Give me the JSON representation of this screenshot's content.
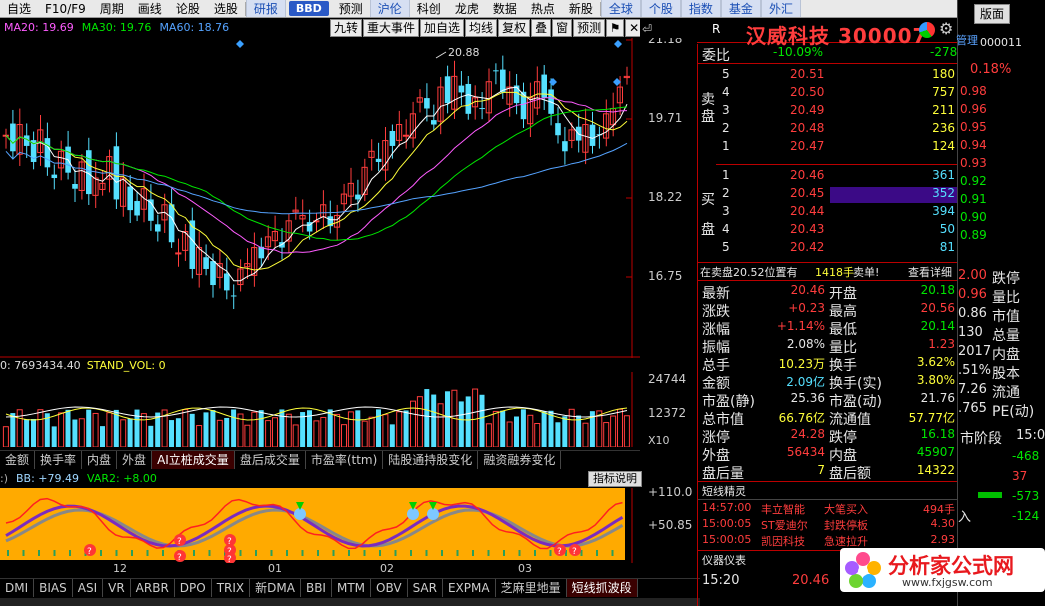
{
  "nav": [
    "自选",
    "F10/F9",
    "周期",
    "画线",
    "论股",
    "选股",
    "研报",
    "BBD",
    "预测",
    "沪伦",
    "科创",
    "龙虎",
    "数据",
    "热点",
    "新股",
    "全球",
    "个股",
    "指数",
    "基金",
    "外汇"
  ],
  "nav_highlight": [
    "研报",
    "沪伦",
    "全球",
    "个股",
    "指数",
    "基金",
    "外汇"
  ],
  "legend": {
    "ma20": "MA20: 19.69",
    "ma30": "MA30: 19.76",
    "ma60": "MA60: 18.76"
  },
  "toolbar": [
    "九转",
    "重大事件",
    "加自选",
    "均线",
    "复权",
    "叠",
    "窗",
    "预测"
  ],
  "price_axis": [
    "21.18",
    "19.71",
    "18.22",
    "16.75"
  ],
  "high_marker": "20.88",
  "volume": {
    "header": "0: 7693434.40",
    "stand_vol": "STAND_VOL: 0",
    "axis": [
      "24744",
      "12372",
      "X10"
    ]
  },
  "tabs1": [
    "金额",
    "换手率",
    "内盘",
    "外盘",
    "AI立桩成交量",
    "盘后成交量",
    "市盈率(ttm)",
    "陆股通持股变化",
    "融资融券变化"
  ],
  "tabs1_active": "AI立桩成交量",
  "indicator": {
    "bb": "BB: +79.49",
    "var2": "VAR2: +8.00",
    "button": "指标说明",
    "axis": [
      "+110.0",
      "+50.85"
    ]
  },
  "x_axis": [
    "12",
    "01",
    "02",
    "03"
  ],
  "tabs2": [
    "DMI",
    "BIAS",
    "ASI",
    "VR",
    "ARBR",
    "DPO",
    "TRIX",
    "新DMA",
    "BBI",
    "MTM",
    "OBV",
    "SAR",
    "EXPMA",
    "芝麻里地量",
    "短线抓波段"
  ],
  "tabs2_active": "短线抓波段",
  "quote": {
    "code_tag": "R",
    "name": "汉威科技 300007",
    "weibi_label": "委比",
    "weibi": "-10.09%",
    "weicha": "-278",
    "sell_label": [
      "卖",
      "盘"
    ],
    "buy_label": [
      "买",
      "盘"
    ],
    "sell": [
      {
        "lvl": "5",
        "price": "20.51",
        "vol": "180"
      },
      {
        "lvl": "4",
        "price": "20.50",
        "vol": "757"
      },
      {
        "lvl": "3",
        "price": "20.49",
        "vol": "211"
      },
      {
        "lvl": "2",
        "price": "20.48",
        "vol": "236"
      },
      {
        "lvl": "1",
        "price": "20.47",
        "vol": "124"
      }
    ],
    "buy": [
      {
        "lvl": "1",
        "price": "20.46",
        "vol": "361"
      },
      {
        "lvl": "2",
        "price": "20.45",
        "vol": "352"
      },
      {
        "lvl": "3",
        "price": "20.44",
        "vol": "394"
      },
      {
        "lvl": "4",
        "price": "20.43",
        "vol": "50"
      },
      {
        "lvl": "5",
        "price": "20.42",
        "vol": "81"
      }
    ],
    "notice": "在卖盘20.52位置有",
    "notice_vol": "1418手",
    "notice_tag": "卖单!",
    "notice_btn": "查看详细",
    "stats": [
      {
        "l": "最新",
        "v": "20.46",
        "c": "red",
        "l2": "开盘",
        "v2": "20.18",
        "c2": "grn"
      },
      {
        "l": "涨跌",
        "v": "+0.23",
        "c": "red",
        "l2": "最高",
        "v2": "20.56",
        "c2": "red"
      },
      {
        "l": "涨幅",
        "v": "+1.14%",
        "c": "red",
        "l2": "最低",
        "v2": "20.14",
        "c2": "grn"
      },
      {
        "l": "振幅",
        "v": "2.08%",
        "c": "wht",
        "l2": "量比",
        "v2": "1.23",
        "c2": "red"
      },
      {
        "l": "总手",
        "v": "10.23万",
        "c": "yel",
        "l2": "换手",
        "v2": "3.62%",
        "c2": "yel"
      },
      {
        "l": "金额",
        "v": "2.09亿",
        "c": "cyn",
        "l2": "换手(实)",
        "v2": "3.80%",
        "c2": "yel"
      },
      {
        "l": "市盈(静)",
        "v": "25.36",
        "c": "wht",
        "l2": "市盈(动)",
        "v2": "21.76",
        "c2": "wht"
      },
      {
        "l": "总市值",
        "v": "66.76亿",
        "c": "yel",
        "l2": "流通值",
        "v2": "57.77亿",
        "c2": "yel"
      },
      {
        "l": "涨停",
        "v": "24.28",
        "c": "red",
        "l2": "跌停",
        "v2": "16.18",
        "c2": "grn"
      },
      {
        "l": "外盘",
        "v": "56434",
        "c": "red",
        "l2": "内盘",
        "v2": "45907",
        "c2": "grn"
      },
      {
        "l": "盘后量",
        "v": "7",
        "c": "yel",
        "l2": "盘后额",
        "v2": "14322",
        "c2": "yel"
      }
    ],
    "elite_title": "短线精灵",
    "elite": [
      {
        "t": "14:57:00",
        "n": "丰立智能",
        "e": "大笔买入",
        "v": "494手"
      },
      {
        "t": "15:00:05",
        "n": "ST爱迪尔",
        "e": "封跌停板",
        "v": "4.30"
      },
      {
        "t": "15:00:05",
        "n": "凯因科技",
        "e": "急速拉升",
        "v": "2.93"
      }
    ],
    "gauge_title": "仪器仪表",
    "gauge_time": "15:20",
    "gauge_val": "20.46"
  },
  "right": {
    "button": "版面",
    "manage": "管理",
    "code": "000011",
    "pct": "0.18%",
    "list": [
      "0.98",
      "0.96",
      "0.95",
      "0.94",
      "0.93",
      "0.92",
      "0.91",
      "0.90",
      "0.89"
    ],
    "stats": [
      {
        "a": "2.00",
        "b": "跌停"
      },
      {
        "a": "0.96",
        "b": "量比"
      },
      {
        "a": "0.86",
        "b": "市值"
      },
      {
        "a": "130",
        "b": "总量"
      },
      {
        "a": "2017",
        "b": "内盘"
      },
      {
        "a": ".51%",
        "b": "股本"
      },
      {
        "a": "7.26",
        "b": "流通"
      },
      {
        "a": ".765",
        "b": "PE(动)"
      }
    ],
    "stage": "市阶段",
    "stage_t": "15:0",
    "flows": [
      "-468",
      "37",
      "-573",
      "-124"
    ],
    "in_label": "入"
  },
  "watermark": {
    "text": "分析家公式网",
    "url": "www.fxjgsw.com"
  }
}
